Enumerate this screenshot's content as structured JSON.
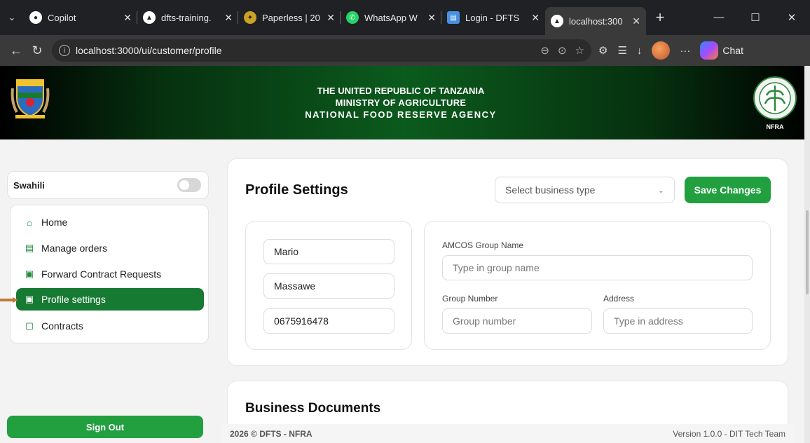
{
  "browser": {
    "tabs": [
      {
        "title": "Copilot",
        "favicon": "github-copilot-icon",
        "active": false
      },
      {
        "title": "dfts-training.",
        "favicon": "vercel-triangle-icon",
        "active": false
      },
      {
        "title": "Paperless | 20",
        "favicon": "paperless-icon",
        "active": false
      },
      {
        "title": "WhatsApp W",
        "favicon": "whatsapp-icon",
        "active": false
      },
      {
        "title": "Login - DFTS",
        "favicon": "doc-icon",
        "active": false
      },
      {
        "title": "localhost:300",
        "favicon": "vercel-triangle-icon",
        "active": true
      }
    ],
    "url": "localhost:3000/ui/customer/profile",
    "copilot_label": "Chat"
  },
  "header": {
    "line1": "THE UNITED REPUBLIC OF TANZANIA",
    "line2": "MINISTRY OF AGRICULTURE",
    "line3": "NATIONAL FOOD RESERVE AGENCY",
    "logo_text": "NFRA"
  },
  "sidebar": {
    "language_label": "Swahili",
    "items": [
      {
        "label": "Home",
        "icon": "home-icon"
      },
      {
        "label": "Manage orders",
        "icon": "orders-icon"
      },
      {
        "label": "Forward Contract Requests",
        "icon": "clipboard-icon"
      },
      {
        "label": "Profile settings",
        "icon": "profile-icon",
        "active": true
      },
      {
        "label": "Contracts",
        "icon": "briefcase-icon"
      }
    ],
    "sign_out": "Sign Out"
  },
  "profile": {
    "title": "Profile Settings",
    "business_type_placeholder": "Select business type",
    "save_label": "Save Changes",
    "first_name": "Mario",
    "last_name": "Massawe",
    "phone": "0675916478",
    "group_name_label": "AMCOS Group Name",
    "group_name_placeholder": "Type in group name",
    "group_number_label": "Group Number",
    "group_number_placeholder": "Group number",
    "address_label": "Address",
    "address_placeholder": "Type in address"
  },
  "documents": {
    "title": "Business Documents"
  },
  "footer": {
    "left": "2026 © DFTS - NFRA",
    "right": "Version 1.0.0 - DIT Tech Team"
  },
  "colors": {
    "brand_green": "#22a040",
    "active_green": "#177a33",
    "header_dark": "#000000"
  }
}
